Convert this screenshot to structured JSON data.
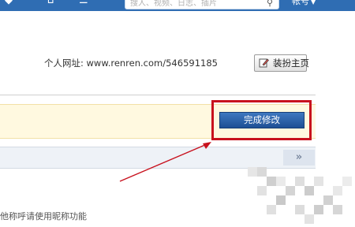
{
  "topbar": {
    "search_placeholder": "搜人、视频、日志、插片",
    "account_label": "帐号",
    "icons": [
      "grid-icon",
      "home-icon",
      "menu-icon"
    ]
  },
  "profile": {
    "url_label": "个人网址:",
    "url_value": "www.renren.com/546591185",
    "dress_button": "装扮主页"
  },
  "notice": {
    "finish_button": "完成修改"
  },
  "panel": {
    "expand_symbol": "»"
  },
  "hint": {
    "text": "他称呼请使用昵称功能"
  },
  "colors": {
    "topbar": "#2f6db3",
    "highlight": "#c8121e",
    "button": "#1d4f94",
    "notice_bg": "#fff9e0"
  }
}
